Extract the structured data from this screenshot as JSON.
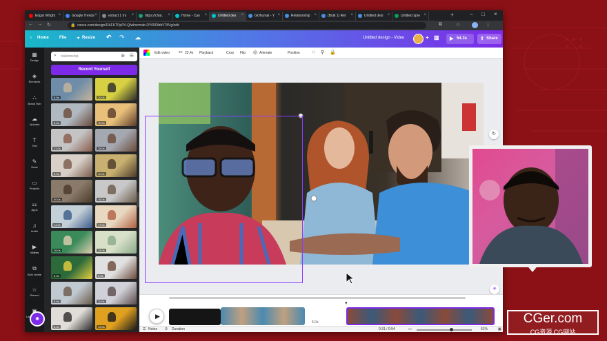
{
  "browser": {
    "tabs": [
      {
        "title": "Edgar Wright",
        "color": "#ff0000"
      },
      {
        "title": "Google Trends",
        "color": "#4285f4"
      },
      {
        "title": "extract 1 mi",
        "color": "#888888"
      },
      {
        "title": "https://chat.",
        "color": "#1a9e6b"
      },
      {
        "title": "Home - Can",
        "color": "#00c4cc"
      },
      {
        "title": "Untitled des",
        "color": "#00c4cc"
      },
      {
        "title": "GOhumal - Y",
        "color": "#4a90e2"
      },
      {
        "title": "Relationship",
        "color": "#4a90e2"
      },
      {
        "title": "(Bulk 1) Rel",
        "color": "#4a90e2"
      },
      {
        "title": "Untitled desi",
        "color": "#4a90e2"
      },
      {
        "title": "Untitled spre",
        "color": "#0f9d58"
      }
    ],
    "active_tab": 5,
    "new_tab": "+",
    "url": "canva.com/design/DAFKTPpPV-Q/whscmab-DY65DlbbV78Vg/edit"
  },
  "canva": {
    "home": "Home",
    "file": "File",
    "resize": "Resize",
    "doc_title": "Untitled design - Video",
    "play_time": "54.3s",
    "share": "Share"
  },
  "rail": [
    {
      "label": "Design",
      "icon": "▦"
    },
    {
      "label": "Elements",
      "icon": "◈"
    },
    {
      "label": "Brand Hub",
      "icon": "⛬"
    },
    {
      "label": "Uploads",
      "icon": "☁"
    },
    {
      "label": "Text",
      "icon": "T"
    },
    {
      "label": "Draw",
      "icon": "✎"
    },
    {
      "label": "Projects",
      "icon": "▭"
    },
    {
      "label": "Apps",
      "icon": "⚏"
    },
    {
      "label": "Audio",
      "icon": "♫"
    },
    {
      "label": "Videos",
      "icon": "▶"
    },
    {
      "label": "Bulk create",
      "icon": "⧉"
    },
    {
      "label": "Starred",
      "icon": "☆"
    },
    {
      "label": "Logo Designs",
      "icon": "▣"
    }
  ],
  "panel": {
    "search_value": "relationship",
    "record_label": "Record Yourself",
    "thumbs": [
      {
        "d": "8.0s",
        "c1": "#6f8da8",
        "c2": "#c7b59a"
      },
      {
        "d": "20.0s",
        "c1": "#d6d042",
        "c2": "#2a2a2a"
      },
      {
        "d": "8.0s",
        "c1": "#b0b8c0",
        "c2": "#6a4a3a"
      },
      {
        "d": "10.0s",
        "c1": "#e8c07a",
        "c2": "#5a3a2a"
      },
      {
        "d": "21.0s",
        "c1": "#c4c4c4",
        "c2": "#8a5a4a"
      },
      {
        "d": "15.0s",
        "c1": "#a4a8b0",
        "c2": "#6a4a3a"
      },
      {
        "d": "8.0s",
        "c1": "#d8d0c8",
        "c2": "#7a5a4a"
      },
      {
        "d": "11.0s",
        "c1": "#c8b070",
        "c2": "#4a3a2a"
      },
      {
        "d": "30.0s",
        "c1": "#8a7a6a",
        "c2": "#4a3a2a"
      },
      {
        "d": "16.0s",
        "c1": "#c8c8c8",
        "c2": "#6a5a4a"
      },
      {
        "d": "14.0s",
        "c1": "#c4d0d8",
        "c2": "#3a5a8a"
      },
      {
        "d": "17.0s",
        "c1": "#e8d8c0",
        "c2": "#b06040"
      },
      {
        "d": "26.0s",
        "c1": "#3a8a5a",
        "c2": "#e0d0b0"
      },
      {
        "d": "15.0s",
        "c1": "#d8e0c8",
        "c2": "#8aaa8a"
      },
      {
        "d": "8.0s",
        "c1": "#2d6a3a",
        "c2": "#e8d040"
      },
      {
        "d": "8.0s",
        "c1": "#e0e0e0",
        "c2": "#6a4a3a"
      },
      {
        "d": "8.0s",
        "c1": "#c0c8d0",
        "c2": "#6a5a4a"
      },
      {
        "d": "11.0s",
        "c1": "#d0d0d8",
        "c2": "#5a4a4a"
      },
      {
        "d": "8.0s",
        "c1": "#e0dcd8",
        "c2": "#2a2a2a"
      },
      {
        "d": "12.0s",
        "c1": "#e0a020",
        "c2": "#1a1a1a"
      }
    ]
  },
  "edit_toolbar": {
    "edit_video": "Edit video",
    "duration": "22.4s",
    "playback": "Playback",
    "crop": "Crop",
    "flip": "Flip",
    "animate": "Animate",
    "position": "Position"
  },
  "timeline": {
    "gap_label": "5.0s",
    "add": "+"
  },
  "bottom": {
    "notes": "Notes",
    "duration": "Duration",
    "time": "0:31 / 0:54",
    "zoom_pct": "61%",
    "zoom_fraction": 0.62
  },
  "watermark": {
    "big": "CGer.com",
    "small": "CG资源  CG网站"
  },
  "colors": {
    "brand_purple": "#7d2ae8",
    "brand_teal": "#18b8c9",
    "background_red": "#8c1116"
  }
}
